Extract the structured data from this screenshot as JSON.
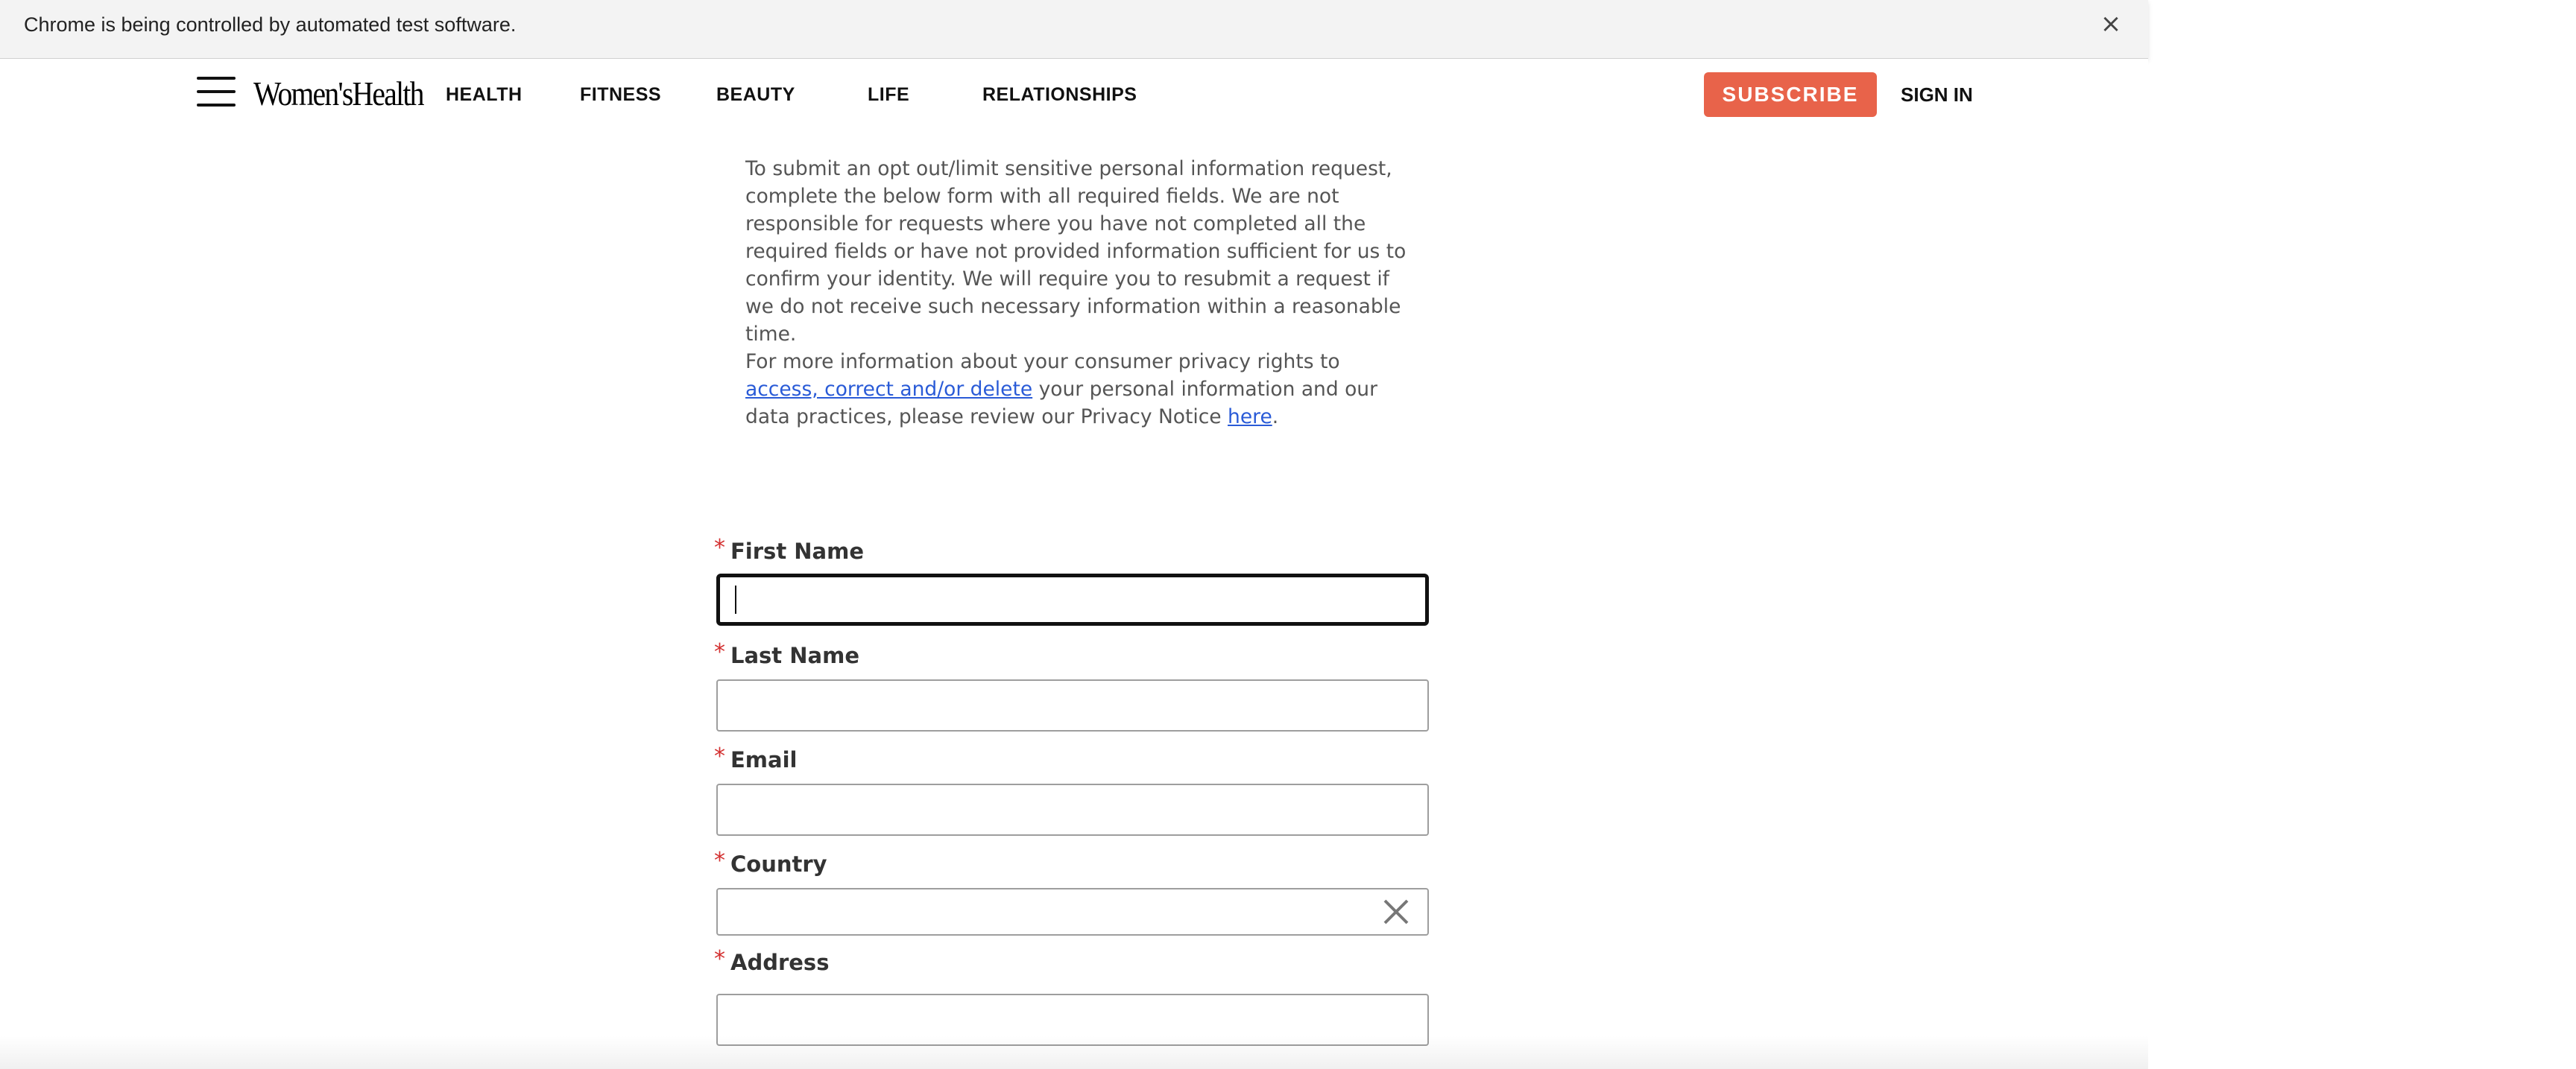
{
  "infobar": {
    "message": "Chrome is being controlled by automated test software.",
    "close_glyph": "×"
  },
  "header": {
    "logo": "Women'sHealth",
    "nav": [
      "HEALTH",
      "FITNESS",
      "BEAUTY",
      "LIFE",
      "RELATIONSHIPS"
    ],
    "subscribe": "SUBSCRIBE",
    "sign_in": "SIGN IN",
    "accent_color": "#e8634a"
  },
  "content": {
    "paragraph1": "To submit an opt out/limit sensitive personal information request, complete the below form with all required fields. We are not responsible for requests where you have not completed all the required fields or have not provided information sufficient for us to confirm your identity. We will require you to resubmit a request if we do not receive such necessary information within a reasonable time.",
    "p2_before": "For more information about your consumer privacy rights to ",
    "p2_link": "access, correct and/or delete",
    "p2_middle": " your personal information and our data practices, please review our Privacy Notice ",
    "p2_link2": "here",
    "p2_end": ".",
    "link_color": "#2a5bd7"
  },
  "form": {
    "required_marker": "*",
    "first_name_label": "First Name",
    "last_name_label": "Last Name",
    "email_label": "Email",
    "country_label": "Country",
    "address_label": "Address",
    "first_name_value": "",
    "last_name_value": "",
    "email_value": "",
    "address_value": "",
    "country_value": ""
  }
}
